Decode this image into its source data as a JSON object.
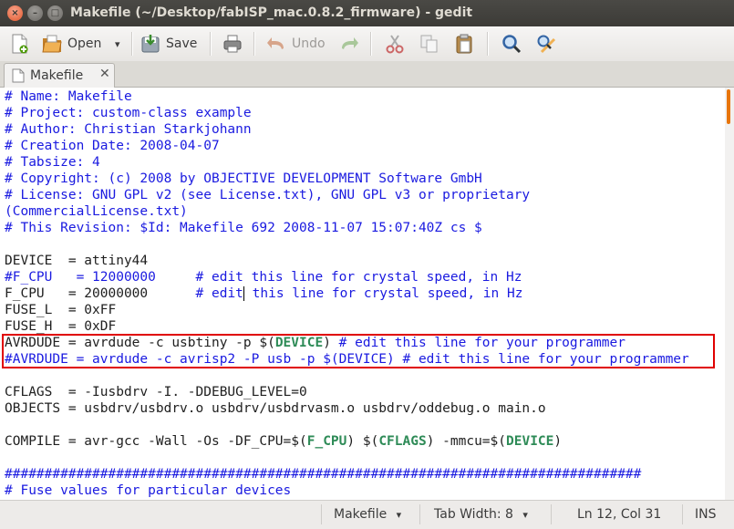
{
  "window": {
    "title": "Makefile (~/Desktop/fabISP_mac.0.8.2_firmware) - gedit",
    "close_glyph": "×",
    "minimize_glyph": "–",
    "maximize_glyph": "□"
  },
  "toolbar": {
    "open_label": "Open",
    "save_label": "Save",
    "undo_label": "Undo",
    "dropdown_glyph": "▾"
  },
  "tabs": [
    {
      "label": "Makefile",
      "close_glyph": "✕"
    }
  ],
  "editor": {
    "lines": [
      "# Name: Makefile",
      "# Project: custom-class example",
      "# Author: Christian Starkjohann",
      "# Creation Date: 2008-04-07",
      "# Tabsize: 4",
      "# Copyright: (c) 2008 by OBJECTIVE DEVELOPMENT Software GmbH",
      "# License: GNU GPL v2 (see License.txt), GNU GPL v3 or proprietary",
      "(CommercialLicense.txt)",
      "# This Revision: $Id: Makefile 692 2008-11-07 15:07:40Z cs $",
      "",
      "DEVICE  = attiny44",
      "#F_CPU   = 12000000",
      "F_CPU   = 20000000",
      "FUSE_L  = 0xFF",
      "FUSE_H  = 0xDF",
      "AVRDUDE = avrdude -c usbtiny -p $(DEVICE)",
      "#AVRDUDE = avrdude -c avrisp2 -P usb -p $(DEVICE) # edit this line for your programmer",
      "",
      "CFLAGS  = -Iusbdrv -I. -DDEBUG_LEVEL=0",
      "OBJECTS = usbdrv/usbdrv.o usbdrv/usbdrvasm.o usbdrv/oddebug.o main.o",
      "",
      "COMPILE = avr-gcc -Wall -Os -DF_CPU=$(F_CPU) $(CFLAGS) -mmcu=$(DEVICE)",
      "",
      "################################################################################",
      "# Fuse values for particular devices"
    ],
    "parts": {
      "fcpu12_comment": "     # edit this line for crystal speed, in Hz",
      "fcpu20_comment_a": "      # edit",
      "fcpu20_comment_b": " this line for crystal speed, in Hz",
      "avrdude_a": "AVRDUDE = avrdude -c usbtiny -p $(",
      "avrdude_device": "DEVICE",
      "avrdude_b": ")",
      "avrdude_comment": " # edit this line for your programmer",
      "compile_a": "COMPILE = avr-gcc -Wall -Os -DF_CPU=$(",
      "compile_fcpu": "F_CPU",
      "compile_b": ") $(",
      "compile_cflags": "CFLAGS",
      "compile_c": ") -mmcu=$(",
      "compile_device": "DEVICE",
      "compile_d": ")"
    }
  },
  "statusbar": {
    "language": "Makefile",
    "tab_width": "Tab Width:  8",
    "position": "Ln 12, Col 31",
    "mode": "INS",
    "dropdown_glyph": "▾"
  },
  "colors": {
    "comment": "#1a1ae0",
    "function": "#2e8b57",
    "highlight_box": "#e00000",
    "scroll_thumb": "#e8750a"
  }
}
